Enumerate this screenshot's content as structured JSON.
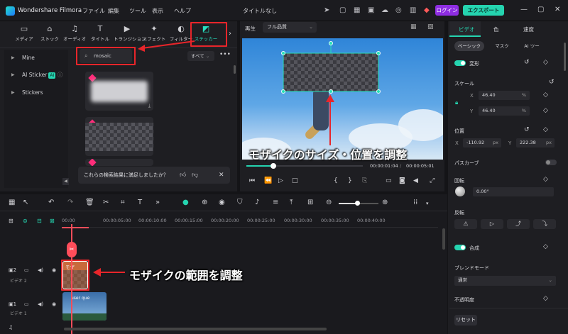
{
  "app_title": "Wondershare Filmora",
  "menus": [
    "ファイル",
    "編集",
    "ツール",
    "表示",
    "ヘルプ"
  ],
  "project_title": "タイトルなし",
  "header_buttons": {
    "login": "ログイン",
    "export": "エクスポート"
  },
  "media_tabs": [
    {
      "label": "メディア",
      "icon": "media-icon"
    },
    {
      "label": "ストック",
      "icon": "stock-icon"
    },
    {
      "label": "オーディオ",
      "icon": "music-icon"
    },
    {
      "label": "タイトル",
      "icon": "title-T-icon"
    },
    {
      "label": "トランジション",
      "icon": "transition-icon"
    },
    {
      "label": "エフェクト",
      "icon": "effects-icon"
    },
    {
      "label": "フィルター",
      "icon": "filter-icon"
    },
    {
      "label": "ステッカー",
      "icon": "sticker-icon",
      "active": true
    }
  ],
  "sidebar": {
    "items": [
      {
        "label": "Mine"
      },
      {
        "label": "AI Sticker",
        "badge": "AI"
      },
      {
        "label": "Stickers"
      }
    ]
  },
  "search": {
    "value": "mosaic",
    "filter": "すべて"
  },
  "feedback": "これらの検索結果に満足しましたか？",
  "preview": {
    "play_label": "再生",
    "quality": "フル品質",
    "time_current": "00:00:01:04",
    "time_total": "00:00:05:01"
  },
  "annotations": {
    "preview": "モザイクのサイズ・位置を調整",
    "timeline": "モザイクの範囲を調整"
  },
  "timeline": {
    "ticks": [
      "00:00",
      "00:00:05:00",
      "00:00:10:00",
      "00:00:15:00",
      "00:00:20:00",
      "00:00:25:00",
      "00:00:30:00",
      "00:00:35:00",
      "00:00:40:00"
    ],
    "tracks": [
      {
        "index": "2",
        "name": "ビデオ 2",
        "clip": "モザ"
      },
      {
        "index": "1",
        "name": "ビデオ 1",
        "clip": "user que"
      }
    ]
  },
  "right_panel": {
    "tabs": [
      "ビデオ",
      "色",
      "速度"
    ],
    "subtabs": [
      "ベーシック",
      "マスク",
      "AI ツー"
    ],
    "transform": "変形",
    "scale": {
      "label": "スケール",
      "x": "46.40",
      "y": "46.40",
      "unit": "%",
      "x_label": "X",
      "y_label": "Y"
    },
    "position": {
      "label": "位置",
      "x": "-110.92",
      "y": "222.38",
      "unit": "px",
      "x_label": "X",
      "y_label": "Y"
    },
    "path_curve": "パスカーブ",
    "rotation": {
      "label": "回転",
      "value": "0.00°"
    },
    "flip": "反転",
    "composite": "合成",
    "blend_mode": {
      "label": "ブレンドモード",
      "value": "通常"
    },
    "opacity": "不透明度",
    "reset": "リセット"
  },
  "colors": {
    "accent": "#25d4b0",
    "highlight": "#e8252a",
    "playhead": "#ff4d5a",
    "login": "#8e2de2"
  }
}
